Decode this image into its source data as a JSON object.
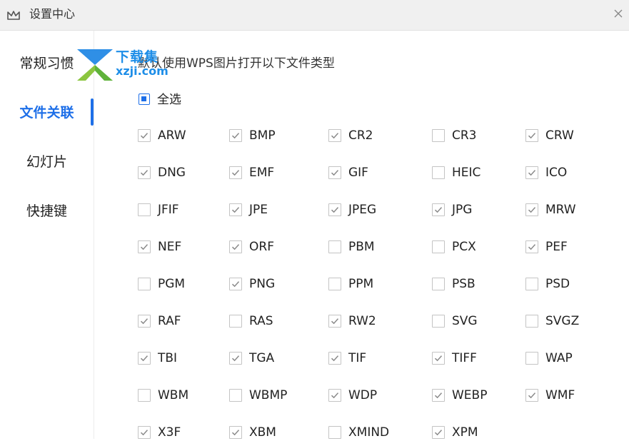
{
  "window": {
    "title": "设置中心"
  },
  "sidebar": {
    "items": [
      {
        "label": "常规习惯",
        "active": false
      },
      {
        "label": "文件关联",
        "active": true
      },
      {
        "label": "幻灯片",
        "active": false
      },
      {
        "label": "快捷键",
        "active": false
      }
    ]
  },
  "watermark": {
    "text": "下载集",
    "sub": "xzji.com"
  },
  "main": {
    "description": "默认使用WPS图片打开以下文件类型",
    "select_all_label": "全选",
    "file_types": [
      {
        "label": "ARW",
        "checked": true
      },
      {
        "label": "BMP",
        "checked": true
      },
      {
        "label": "CR2",
        "checked": true
      },
      {
        "label": "CR3",
        "checked": false
      },
      {
        "label": "CRW",
        "checked": true
      },
      {
        "label": "DNG",
        "checked": true
      },
      {
        "label": "EMF",
        "checked": true
      },
      {
        "label": "GIF",
        "checked": true
      },
      {
        "label": "HEIC",
        "checked": false
      },
      {
        "label": "ICO",
        "checked": true
      },
      {
        "label": "JFIF",
        "checked": false
      },
      {
        "label": "JPE",
        "checked": true
      },
      {
        "label": "JPEG",
        "checked": true
      },
      {
        "label": "JPG",
        "checked": true
      },
      {
        "label": "MRW",
        "checked": true
      },
      {
        "label": "NEF",
        "checked": true
      },
      {
        "label": "ORF",
        "checked": true
      },
      {
        "label": "PBM",
        "checked": false
      },
      {
        "label": "PCX",
        "checked": false
      },
      {
        "label": "PEF",
        "checked": true
      },
      {
        "label": "PGM",
        "checked": false
      },
      {
        "label": "PNG",
        "checked": true
      },
      {
        "label": "PPM",
        "checked": false
      },
      {
        "label": "PSB",
        "checked": false
      },
      {
        "label": "PSD",
        "checked": false
      },
      {
        "label": "RAF",
        "checked": true
      },
      {
        "label": "RAS",
        "checked": false
      },
      {
        "label": "RW2",
        "checked": true
      },
      {
        "label": "SVG",
        "checked": false
      },
      {
        "label": "SVGZ",
        "checked": false
      },
      {
        "label": "TBI",
        "checked": true
      },
      {
        "label": "TGA",
        "checked": true
      },
      {
        "label": "TIF",
        "checked": true
      },
      {
        "label": "TIFF",
        "checked": true
      },
      {
        "label": "WAP",
        "checked": false
      },
      {
        "label": "WBM",
        "checked": false
      },
      {
        "label": "WBMP",
        "checked": false
      },
      {
        "label": "WDP",
        "checked": true
      },
      {
        "label": "WEBP",
        "checked": true
      },
      {
        "label": "WMF",
        "checked": true
      },
      {
        "label": "X3F",
        "checked": true
      },
      {
        "label": "XBM",
        "checked": true
      },
      {
        "label": "XMIND",
        "checked": false
      },
      {
        "label": "XPM",
        "checked": true
      }
    ]
  },
  "colors": {
    "accent": "#1e6fe8",
    "checkbox_border": "#c4c4c4",
    "checkmark": "#8a8a8a"
  }
}
